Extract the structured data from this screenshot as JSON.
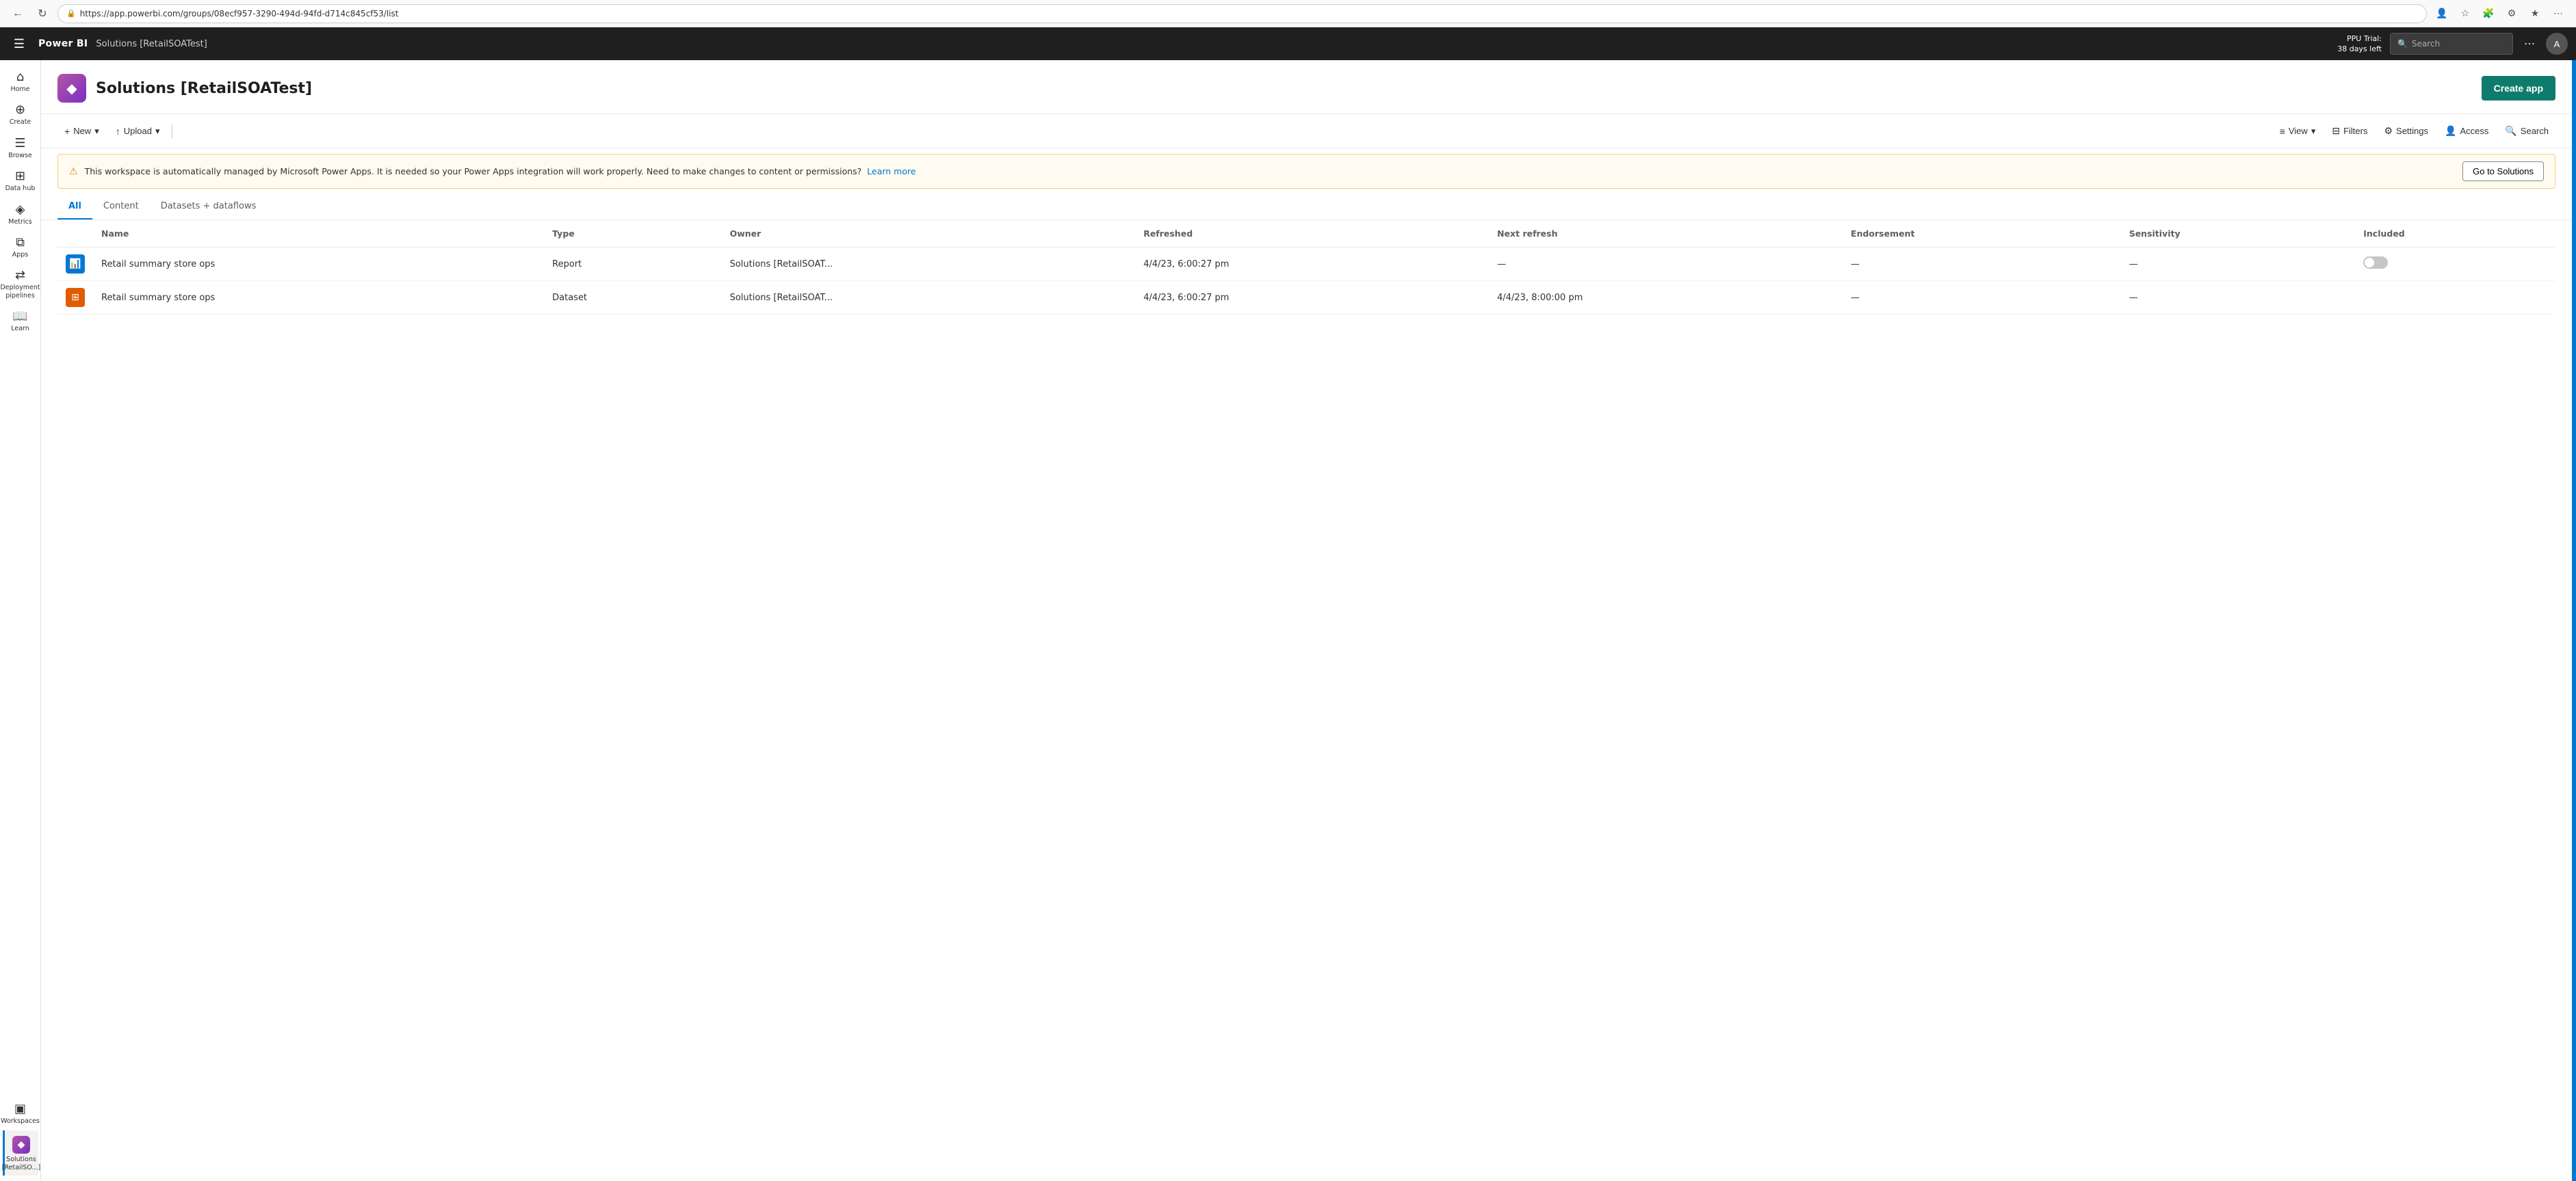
{
  "browser": {
    "url": "https://app.powerbi.com/groups/08ecf957-3290-494d-94fd-d714c845cf53/list",
    "back_icon": "←",
    "refresh_icon": "↻"
  },
  "topnav": {
    "app_name": "Power BI",
    "workspace_name": "Solutions [RetailSOATest]",
    "ppu_trial_line1": "PPU Trial:",
    "ppu_trial_line2": "38 days left",
    "search_placeholder": "Search"
  },
  "sidebar": {
    "items": [
      {
        "id": "home",
        "label": "Home",
        "icon": "⌂"
      },
      {
        "id": "create",
        "label": "Create",
        "icon": "+"
      },
      {
        "id": "browse",
        "label": "Browse",
        "icon": "☰"
      },
      {
        "id": "datahub",
        "label": "Data hub",
        "icon": "⊞"
      },
      {
        "id": "metrics",
        "label": "Metrics",
        "icon": "◈"
      },
      {
        "id": "apps",
        "label": "Apps",
        "icon": "⧉"
      },
      {
        "id": "deployment",
        "label": "Deployment pipelines",
        "icon": "⇄"
      },
      {
        "id": "learn",
        "label": "Learn",
        "icon": "📖"
      },
      {
        "id": "workspaces",
        "label": "Workspaces",
        "icon": "▣"
      },
      {
        "id": "solutions",
        "label": "Solutions [RetailSO...]",
        "icon": "◆",
        "active": true
      }
    ]
  },
  "page": {
    "title": "Solutions [RetailSOATest]",
    "create_app_label": "Create app"
  },
  "toolbar": {
    "new_label": "New",
    "upload_label": "Upload",
    "view_label": "View",
    "filters_label": "Filters",
    "settings_label": "Settings",
    "access_label": "Access",
    "search_label": "Search"
  },
  "warning": {
    "text": "This workspace is automatically managed by Microsoft Power Apps. It is needed so your Power Apps integration will work properly. Need to make changes to content or permissions?",
    "learn_more_label": "Learn more",
    "go_to_solutions_label": "Go to Solutions"
  },
  "tabs": [
    {
      "id": "all",
      "label": "All",
      "active": true
    },
    {
      "id": "content",
      "label": "Content"
    },
    {
      "id": "datasets",
      "label": "Datasets + dataflows"
    }
  ],
  "table": {
    "columns": [
      {
        "id": "name",
        "label": "Name"
      },
      {
        "id": "type",
        "label": "Type"
      },
      {
        "id": "owner",
        "label": "Owner"
      },
      {
        "id": "refreshed",
        "label": "Refreshed"
      },
      {
        "id": "next_refresh",
        "label": "Next refresh"
      },
      {
        "id": "endorsement",
        "label": "Endorsement"
      },
      {
        "id": "sensitivity",
        "label": "Sensitivity"
      },
      {
        "id": "included",
        "label": "Included"
      }
    ],
    "rows": [
      {
        "name": "Retail summary store ops",
        "type": "Report",
        "icon_type": "report",
        "icon_symbol": "📊",
        "owner": "Solutions [RetailSOAT...",
        "refreshed": "4/4/23, 6:00:27 pm",
        "next_refresh": "—",
        "endorsement": "—",
        "sensitivity": "—",
        "included": "toggle"
      },
      {
        "name": "Retail summary store ops",
        "type": "Dataset",
        "icon_type": "dataset",
        "icon_symbol": "⬛",
        "owner": "Solutions [RetailSOAT...",
        "refreshed": "4/4/23, 6:00:27 pm",
        "next_refresh": "4/4/23, 8:00:00 pm",
        "endorsement": "—",
        "sensitivity": "—",
        "included": ""
      }
    ]
  }
}
